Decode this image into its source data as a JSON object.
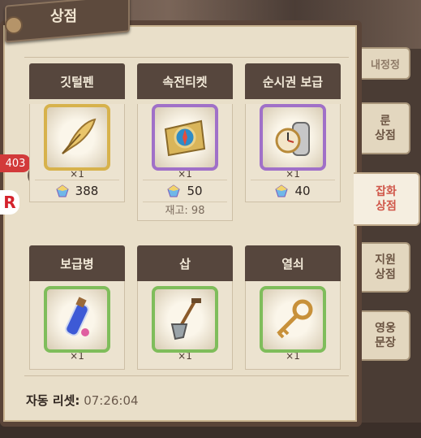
{
  "title": "상점",
  "side_tabs": [
    {
      "label": "내정정",
      "active": false
    },
    {
      "label": "룬 상점",
      "active": false
    },
    {
      "label": "잡화 상점",
      "active": true
    },
    {
      "label": "지원 상점",
      "active": false
    },
    {
      "label": "영웅 문장",
      "active": false
    }
  ],
  "items": [
    {
      "name": "깃털펜",
      "qty": "×1",
      "price": "388",
      "stock": "",
      "frame": "gold",
      "icon": "quill-icon"
    },
    {
      "name": "속전티켓",
      "qty": "×1",
      "price": "50",
      "stock": "재고: 98",
      "frame": "purple",
      "icon": "compass-map-icon"
    },
    {
      "name": "순시권 보급",
      "qty": "×1",
      "price": "40",
      "stock": "",
      "frame": "purple",
      "icon": "pocket-watch-canister-icon"
    },
    {
      "name": "보급병",
      "qty": "×1",
      "frame": "green",
      "icon": "potion-vial-icon"
    },
    {
      "name": "삽",
      "qty": "×1",
      "frame": "green",
      "icon": "shovel-icon"
    },
    {
      "name": "열쇠",
      "qty": "×1",
      "frame": "green",
      "icon": "key-icon"
    }
  ],
  "reset": {
    "label": "자동 리셋:",
    "time": "07:26:04"
  },
  "side_badge": "403",
  "colors": {
    "gold": "#d7b24c",
    "purple": "#a070c8",
    "green": "#7fbd5b",
    "accent": "#d0574a"
  }
}
